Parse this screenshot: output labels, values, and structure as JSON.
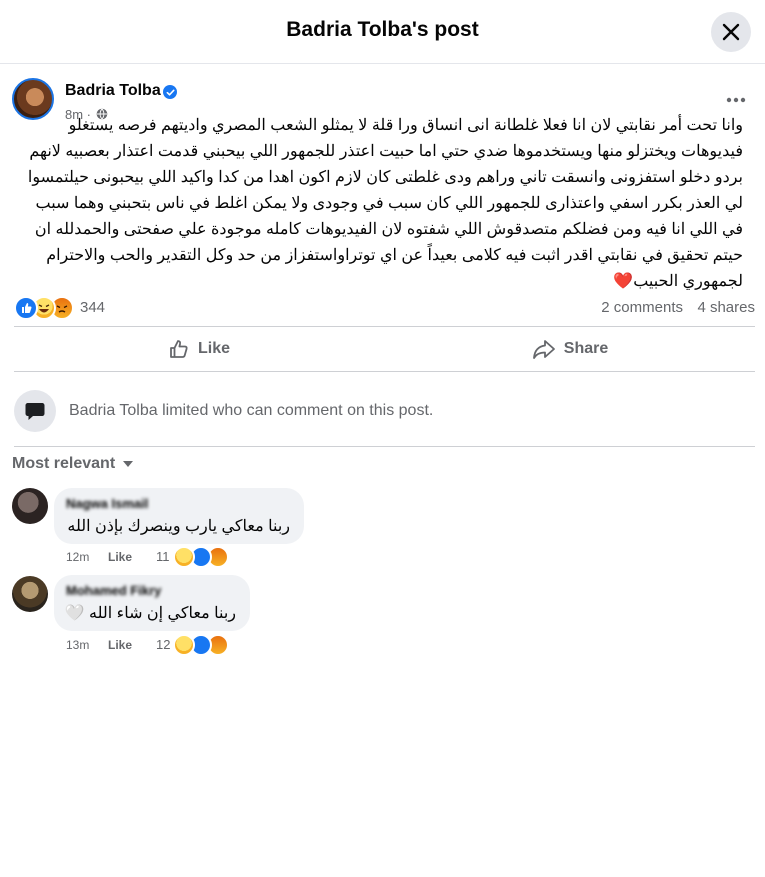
{
  "header": {
    "title": "Badria Tolba's post"
  },
  "post": {
    "author": "Badria Tolba",
    "time": "8m",
    "lines": [
      "وانا تحت أمر نقابتي لان انا فعلا غلطانة انى انساق ورا قلة لا يمثلو الشعب المصري واديتهم فرصه يستغلو",
      "فيديوهات ويختزلو منها ويستخدموها ضدي حتي اما حبيت اعتذر للجمهور اللي بيحبني قدمت اعتذار بعصبيه لانهم",
      "بردو دخلو استفزونى وانسقت تاني وراهم ودى غلطتى كان لازم اكون اهدا من كدا واكيد اللي بيحبونى حيلتمسوا",
      "لي العذر بكرر اسفي واعتذارى للجمهور اللي كان سبب في وجودى ولا يمكن اغلط في ناس بتحبني وهما سبب",
      "في اللي انا فيه ومن فضلكم متصدقوش اللي شفتوه لان الفيديوهات كامله موجودة علي صفحتى والحمدلله ان",
      "حيتم تحقيق في نقابتي اقدر اثبت فيه كلامى بعيداً عن اي توتراواستفزاز من حد وكل التقدير والحب والاحترام",
      "لجمهوري الحبيب❤️"
    ],
    "reaction_count": "344",
    "comments_label": "2 comments",
    "shares_label": "4 shares"
  },
  "actions": {
    "like": "Like",
    "share": "Share"
  },
  "limited_notice": "Badria Tolba limited who can comment on this post.",
  "sort_label": "Most relevant",
  "comments": [
    {
      "name": "Nagwa Ismail",
      "text": "ربنا معاكي يارب وينصرك بإذن الله",
      "time": "12m",
      "like": "Like",
      "reactions": "11"
    },
    {
      "name": "Mohamed Fikry",
      "text": "ربنا معاكي إن شاء الله 🤍",
      "time": "13m",
      "like": "Like",
      "reactions": "12"
    }
  ],
  "colors": {
    "accent": "#1877f2",
    "muted": "#65676b",
    "bubble": "#f0f2f5"
  }
}
